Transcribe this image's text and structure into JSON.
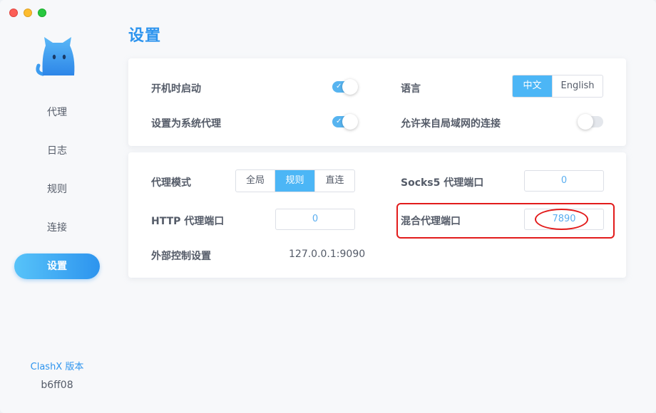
{
  "window": {
    "controls": [
      "close",
      "minimize",
      "zoom"
    ]
  },
  "sidebar": {
    "logo_icon": "cat-logo-icon",
    "items": [
      {
        "label": "代理",
        "active": false
      },
      {
        "label": "日志",
        "active": false
      },
      {
        "label": "规则",
        "active": false
      },
      {
        "label": "连接",
        "active": false
      },
      {
        "label": "设置",
        "active": true
      }
    ],
    "version_label": "ClashX 版本",
    "version_value": "b6ff08"
  },
  "main": {
    "title": "设置",
    "general": {
      "launch_at_login": {
        "label": "开机时启动",
        "on": true
      },
      "system_proxy": {
        "label": "设置为系统代理",
        "on": true
      },
      "language": {
        "label": "语言",
        "options": [
          "中文",
          "English"
        ],
        "selected": "中文"
      },
      "allow_lan": {
        "label": "允许来自局域网的连接",
        "on": false
      }
    },
    "proxy": {
      "mode": {
        "label": "代理模式",
        "options": [
          "全局",
          "规则",
          "直连"
        ],
        "selected": "规则"
      },
      "socks5_port": {
        "label": "Socks5 代理端口",
        "value": "0"
      },
      "http_port": {
        "label": "HTTP 代理端口",
        "value": "0"
      },
      "mixed_port": {
        "label": "混合代理端口",
        "value": "7890"
      },
      "external_controller": {
        "label": "外部控制设置",
        "value": "127.0.0.1:9090"
      }
    }
  },
  "colors": {
    "accent": "#2d94ee",
    "toggle_on": "#57b4f0",
    "annotation": "#e21b1b"
  }
}
